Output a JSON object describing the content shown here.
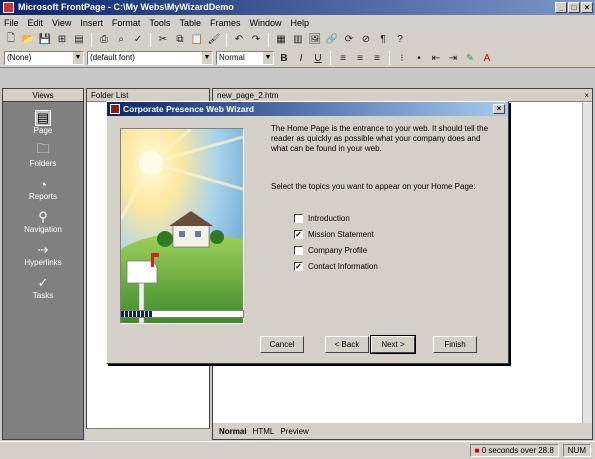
{
  "app": {
    "title": "Microsoft FrontPage - C:\\My Webs\\MyWizardDemo",
    "window_buttons": [
      "_",
      "□",
      "×"
    ]
  },
  "menu": [
    "File",
    "Edit",
    "View",
    "Insert",
    "Format",
    "Tools",
    "Table",
    "Frames",
    "Window",
    "Help"
  ],
  "toolbar2": {
    "style": "(None)",
    "font": "(default font)",
    "size": "Normal"
  },
  "views": {
    "header": "Views",
    "items": [
      {
        "label": "Page",
        "icon": "page-icon",
        "selected": true
      },
      {
        "label": "Folders",
        "icon": "folders-icon",
        "selected": false
      },
      {
        "label": "Reports",
        "icon": "reports-icon",
        "selected": false
      },
      {
        "label": "Navigation",
        "icon": "navigation-icon",
        "selected": false
      },
      {
        "label": "Hyperlinks",
        "icon": "hyperlinks-icon",
        "selected": false
      },
      {
        "label": "Tasks",
        "icon": "tasks-icon",
        "selected": false
      }
    ]
  },
  "folder_list": {
    "header": "Folder List"
  },
  "editor": {
    "tab": "new_page_2.htm",
    "bottom_tabs": [
      "Normal",
      "HTML",
      "Preview"
    ]
  },
  "status": {
    "timing": "0 seconds over 28.8",
    "num": "NUM"
  },
  "dialog": {
    "title": "Corporate Presence Web Wizard",
    "description": "The Home Page is the entrance to your web. It should tell the reader as quickly as possible what your company does and what can be found in your web.",
    "prompt": "Select the topics you want to appear on your Home Page:",
    "topics": [
      {
        "label": "Introduction",
        "checked": false
      },
      {
        "label": "Mission Statement",
        "checked": true
      },
      {
        "label": "Company Profile",
        "checked": false
      },
      {
        "label": "Contact Information",
        "checked": true
      }
    ],
    "progress": 0.25,
    "buttons": {
      "cancel": "Cancel",
      "back": "< Back",
      "next": "Next >",
      "finish": "Finish"
    }
  },
  "colors": {
    "title_bar": "#0a246a",
    "face": "#d4d0c8",
    "views_bg": "#808080"
  }
}
